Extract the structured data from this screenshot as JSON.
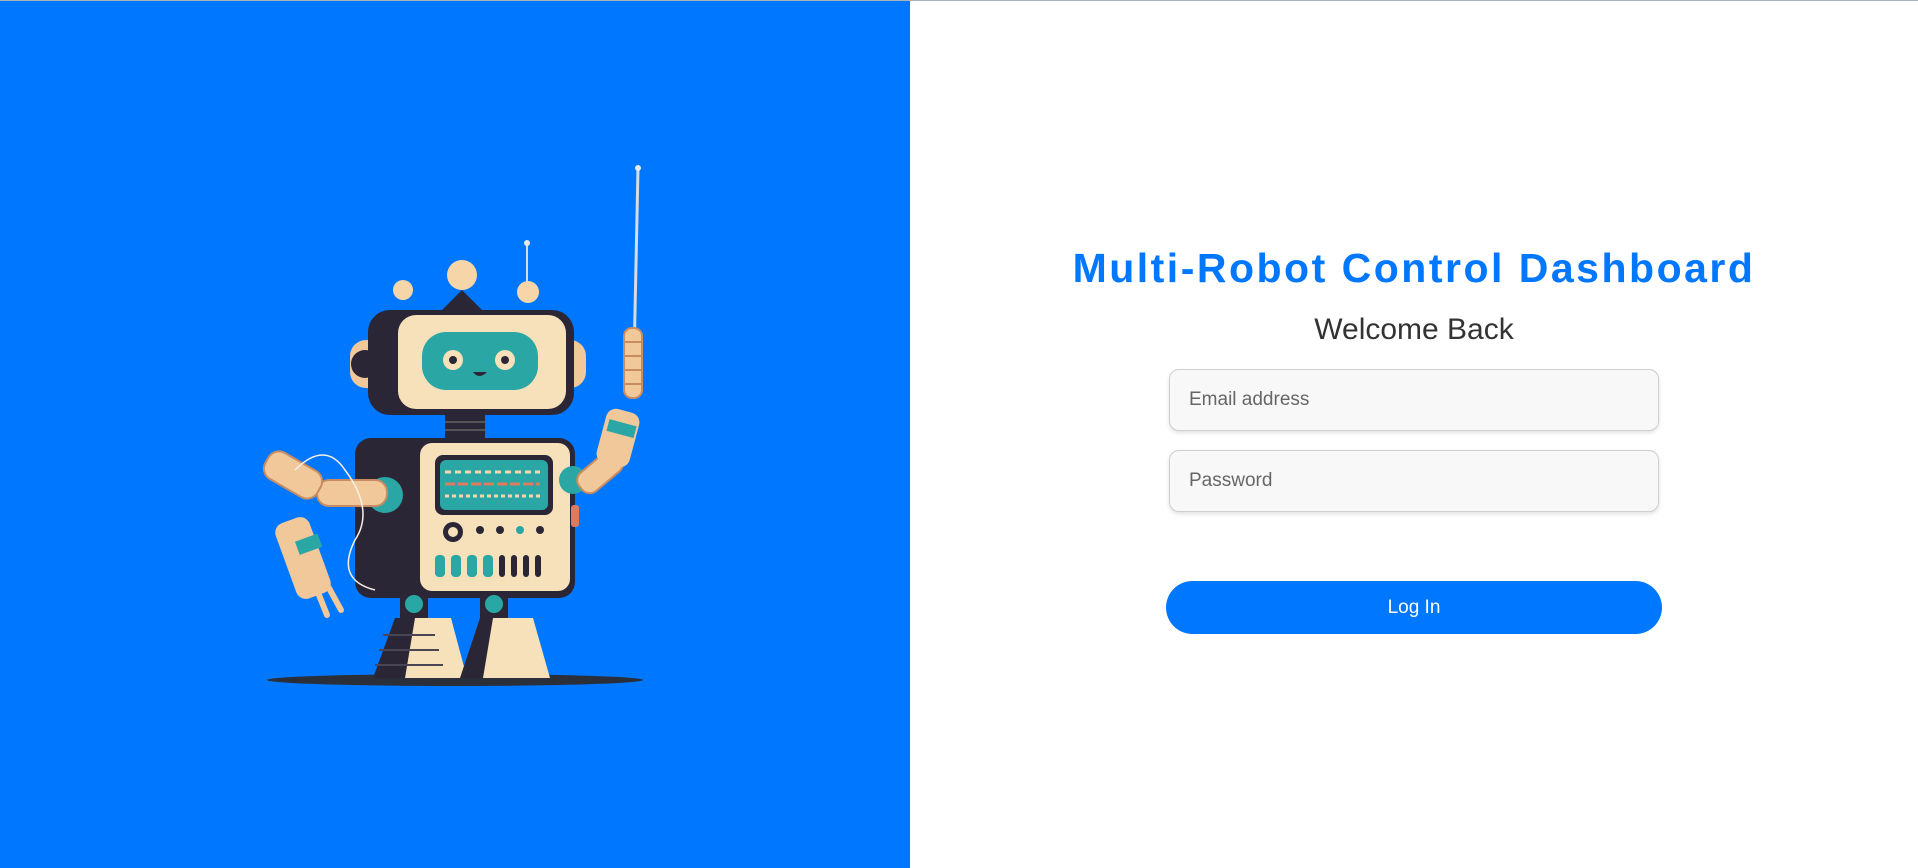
{
  "brand": {
    "accent_color": "#0077ff",
    "illustration": "robot-illustration"
  },
  "login": {
    "title": "Multi-Robot Control Dashboard",
    "subtitle": "Welcome Back",
    "email_placeholder": "Email address",
    "password_placeholder": "Password",
    "submit_label": "Log In"
  }
}
